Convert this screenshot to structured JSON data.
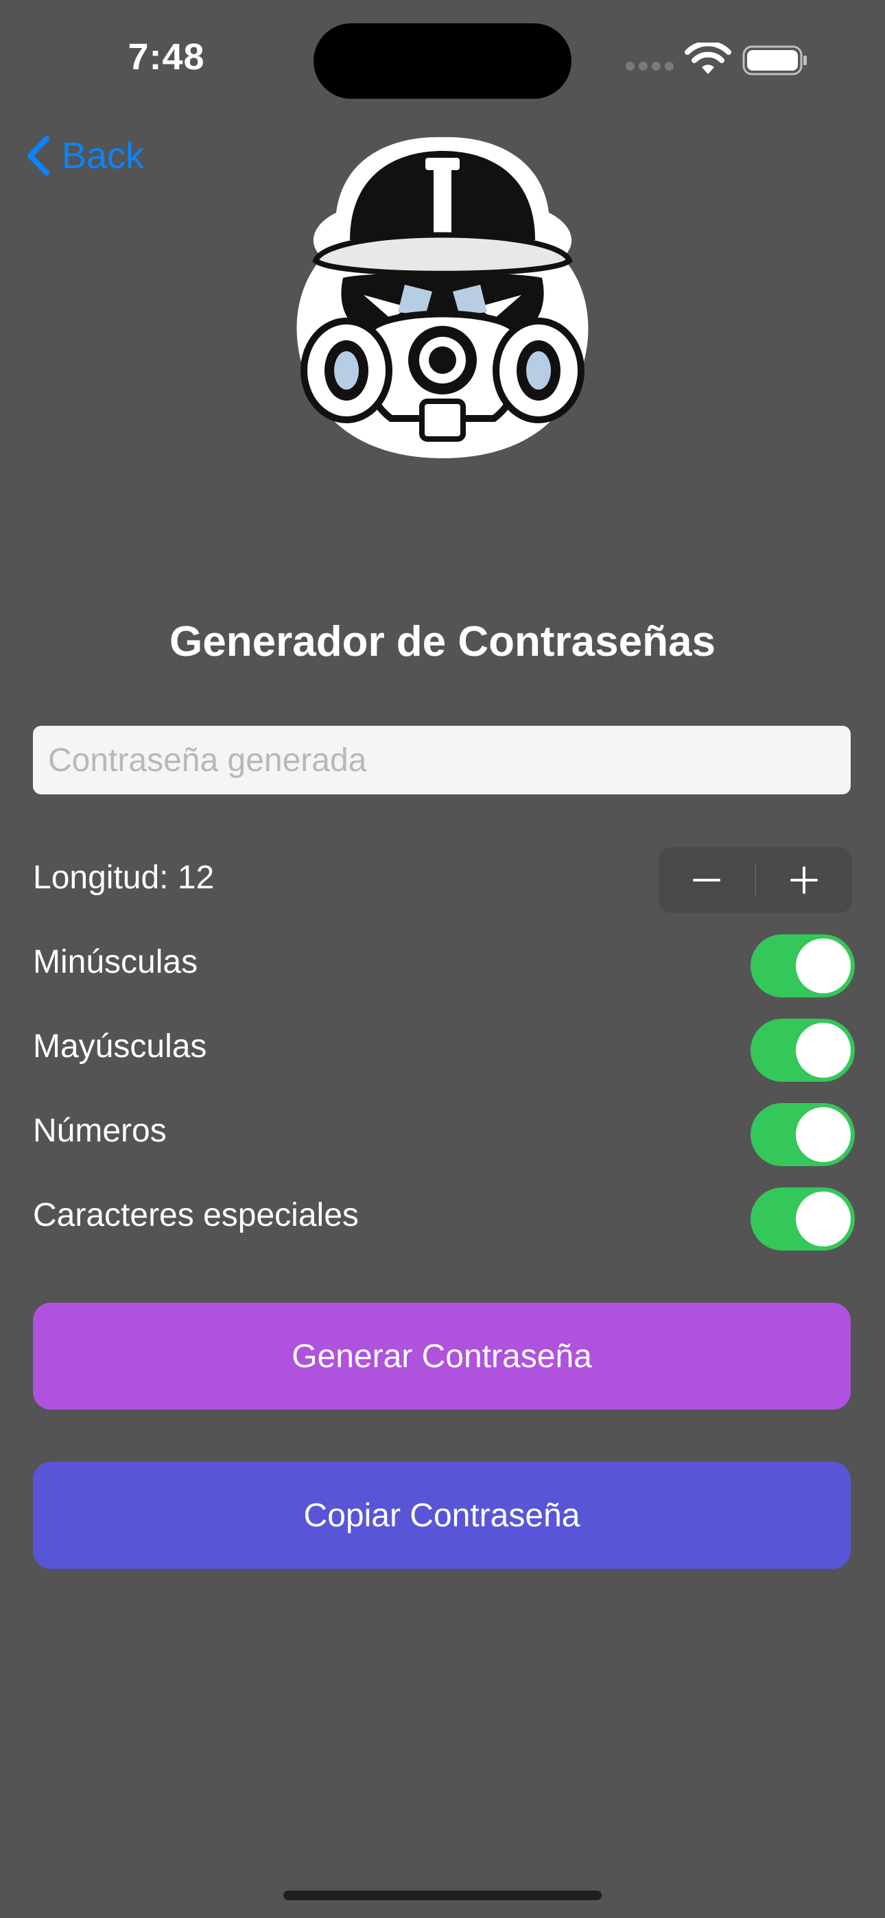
{
  "status_bar": {
    "time": "7:48"
  },
  "nav": {
    "back_label": "Back"
  },
  "main": {
    "title": "Generador de Contraseñas",
    "password_field": {
      "value": "",
      "placeholder": "Contraseña generada"
    },
    "length": {
      "label": "Longitud: 12",
      "value": 12
    },
    "options": [
      {
        "label": "Minúsculas",
        "on": true
      },
      {
        "label": "Mayúsculas",
        "on": true
      },
      {
        "label": "Números",
        "on": true
      },
      {
        "label": "Caracteres especiales",
        "on": true
      }
    ],
    "generate_button": {
      "label": "Generar Contraseña",
      "color": "#af52de"
    },
    "copy_button": {
      "label": "Copiar Contraseña",
      "color": "#5856d6"
    }
  },
  "colors": {
    "background": "#545454",
    "accent": "#0a84ff",
    "toggle_on": "#34c759"
  },
  "icons": {
    "back": "chevron-left-icon",
    "wifi": "wifi-icon",
    "battery": "battery-icon",
    "logo": "gas-mask-logo"
  }
}
